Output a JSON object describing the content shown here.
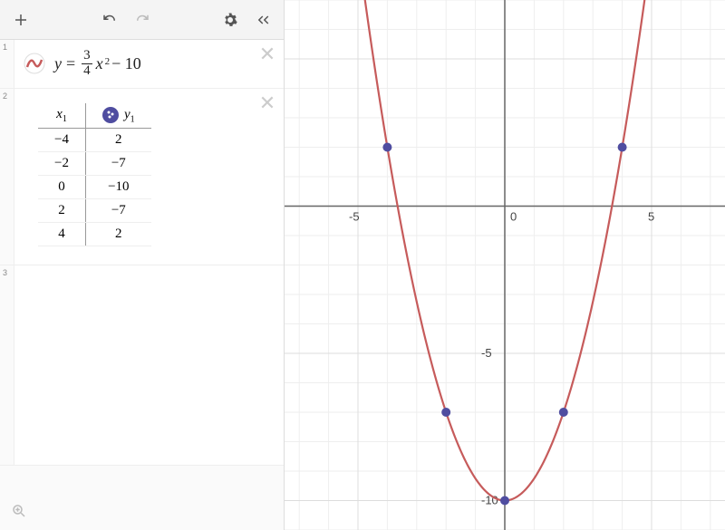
{
  "toolbar": {
    "add_label": "+",
    "undo_label": "undo",
    "redo_label": "redo",
    "settings_label": "settings",
    "collapse_label": "«"
  },
  "expressions": [
    {
      "index": "1",
      "kind": "formula",
      "y_eq": "y",
      "equals": "=",
      "frac_num": "3",
      "frac_den": "4",
      "x_var": "x",
      "power": "2",
      "tail": " − 10",
      "color": "#c65b5b"
    },
    {
      "index": "2",
      "kind": "table",
      "col_x": "x",
      "col_x_sub": "1",
      "col_y": "y",
      "col_y_sub": "1",
      "rows": [
        {
          "x": "−4",
          "y": "2"
        },
        {
          "x": "−2",
          "y": "−7"
        },
        {
          "x": "0",
          "y": "−10"
        },
        {
          "x": "2",
          "y": "−7"
        },
        {
          "x": "4",
          "y": "2"
        }
      ],
      "point_color": "#4f4da0"
    },
    {
      "index": "3",
      "kind": "empty"
    }
  ],
  "chart_data": {
    "type": "scatter+line",
    "title": "",
    "xlabel": "",
    "ylabel": "",
    "xlim": [
      -7.5,
      7.5
    ],
    "ylim": [
      -11,
      7
    ],
    "xticks": [
      -5,
      0,
      5
    ],
    "yticks": [
      -10,
      -5,
      0
    ],
    "grid": true,
    "series": [
      {
        "name": "y = (3/4)x^2 - 10",
        "type": "curve",
        "color": "#c65b5b",
        "equation": {
          "a": 0.75,
          "b": 0,
          "c": -10
        }
      },
      {
        "name": "table points",
        "type": "points",
        "color": "#4f4da0",
        "x": [
          -4,
          -2,
          0,
          2,
          4
        ],
        "y": [
          2,
          -7,
          -10,
          -7,
          2
        ]
      }
    ]
  }
}
